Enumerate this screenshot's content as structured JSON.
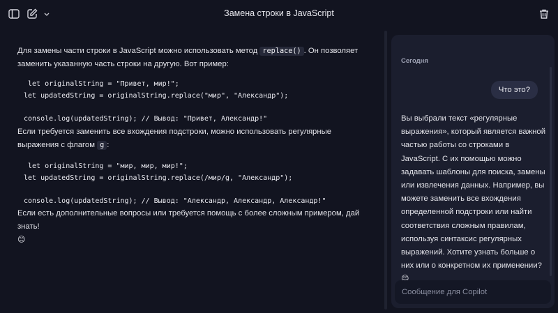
{
  "header": {
    "title": "Замена строки в JavaScript",
    "icons": [
      "sidebar-toggle-icon",
      "new-chat-icon",
      "chevron-down-icon",
      "trash-icon"
    ]
  },
  "chat": {
    "p1_before": "Для замены части строки в JavaScript можно использовать метод ",
    "p1_code": "replace()",
    "p1_after": ". Он позволяет заменить указанную часть строки на другую. Вот пример:",
    "code1": " let originalString = \"Привет, мир!\";\nlet updatedString = originalString.replace(\"мир\", \"Александр\");\n\nconsole.log(updatedString); // Вывод: \"Привет, Александр!\"",
    "p2_before": "Если требуется заменить все вхождения подстроки, можно использовать регулярные выражения с флагом ",
    "p2_code": "g",
    "p2_after": ":",
    "code2": " let originalString = \"мир, мир, мир!\";\nlet updatedString = originalString.replace(/мир/g, \"Александр\");\n\nconsole.log(updatedString); // Вывод: \"Александр, Александр, Александр!\"",
    "p3": "Если есть дополнительные вопросы или требуется помощь с более сложным примером, дай знать!",
    "p3_emoji": "😊"
  },
  "copilot": {
    "date_label": "Сегодня",
    "user_message": "Что это?",
    "assistant_message": "Вы выбрали текст «регулярные выражения», который является важной частью работы со строками в JavaScript. С их помощью можно задавать шаблоны для поиска, замены или извлечения данных. Например, вы можете заменить все вхождения определенной подстроки или найти соответствия сложным правилам, используя синтаксис регулярных выражений. Хотите узнать больше о них или о конкретном их применении?",
    "assistant_emoji": "😊",
    "input_placeholder": "Сообщение для Copilot"
  }
}
